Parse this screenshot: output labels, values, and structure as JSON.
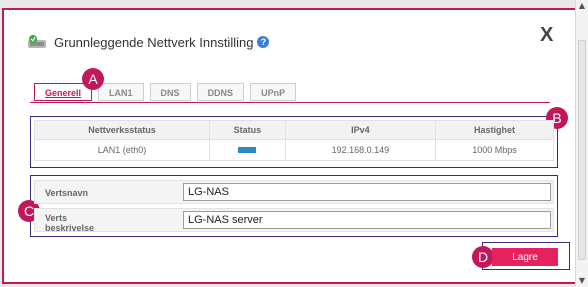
{
  "dialog": {
    "title": "Grunnleggende Nettverk Innstilling",
    "help_icon": "?",
    "close_label": "X"
  },
  "tabs": [
    {
      "label": "Generell",
      "active": true
    },
    {
      "label": "LAN1",
      "active": false
    },
    {
      "label": "DNS",
      "active": false
    },
    {
      "label": "DDNS",
      "active": false
    },
    {
      "label": "UPnP",
      "active": false
    }
  ],
  "annotations": {
    "a": "A",
    "b": "B",
    "c": "C",
    "d": "D"
  },
  "status_table": {
    "headers": [
      "Nettverksstatus",
      "Status",
      "IPv4",
      "Hastighet"
    ],
    "row": {
      "name": "LAN1 (eth0)",
      "ipv4": "192.168.0.149",
      "speed": "1000 Mbps"
    }
  },
  "form": {
    "hostname_label": "Vertsnavn",
    "hostname_value": "LG-NAS",
    "description_label_line1": "Verts",
    "description_label_line2": "beskrivelse",
    "description_value": "LG-NAS server"
  },
  "actions": {
    "save_label": "Lagre"
  },
  "colors": {
    "accent": "#c2185b",
    "button": "#e5225f",
    "status": "#2e88c8",
    "annotation_border": "#3a2a8a"
  }
}
